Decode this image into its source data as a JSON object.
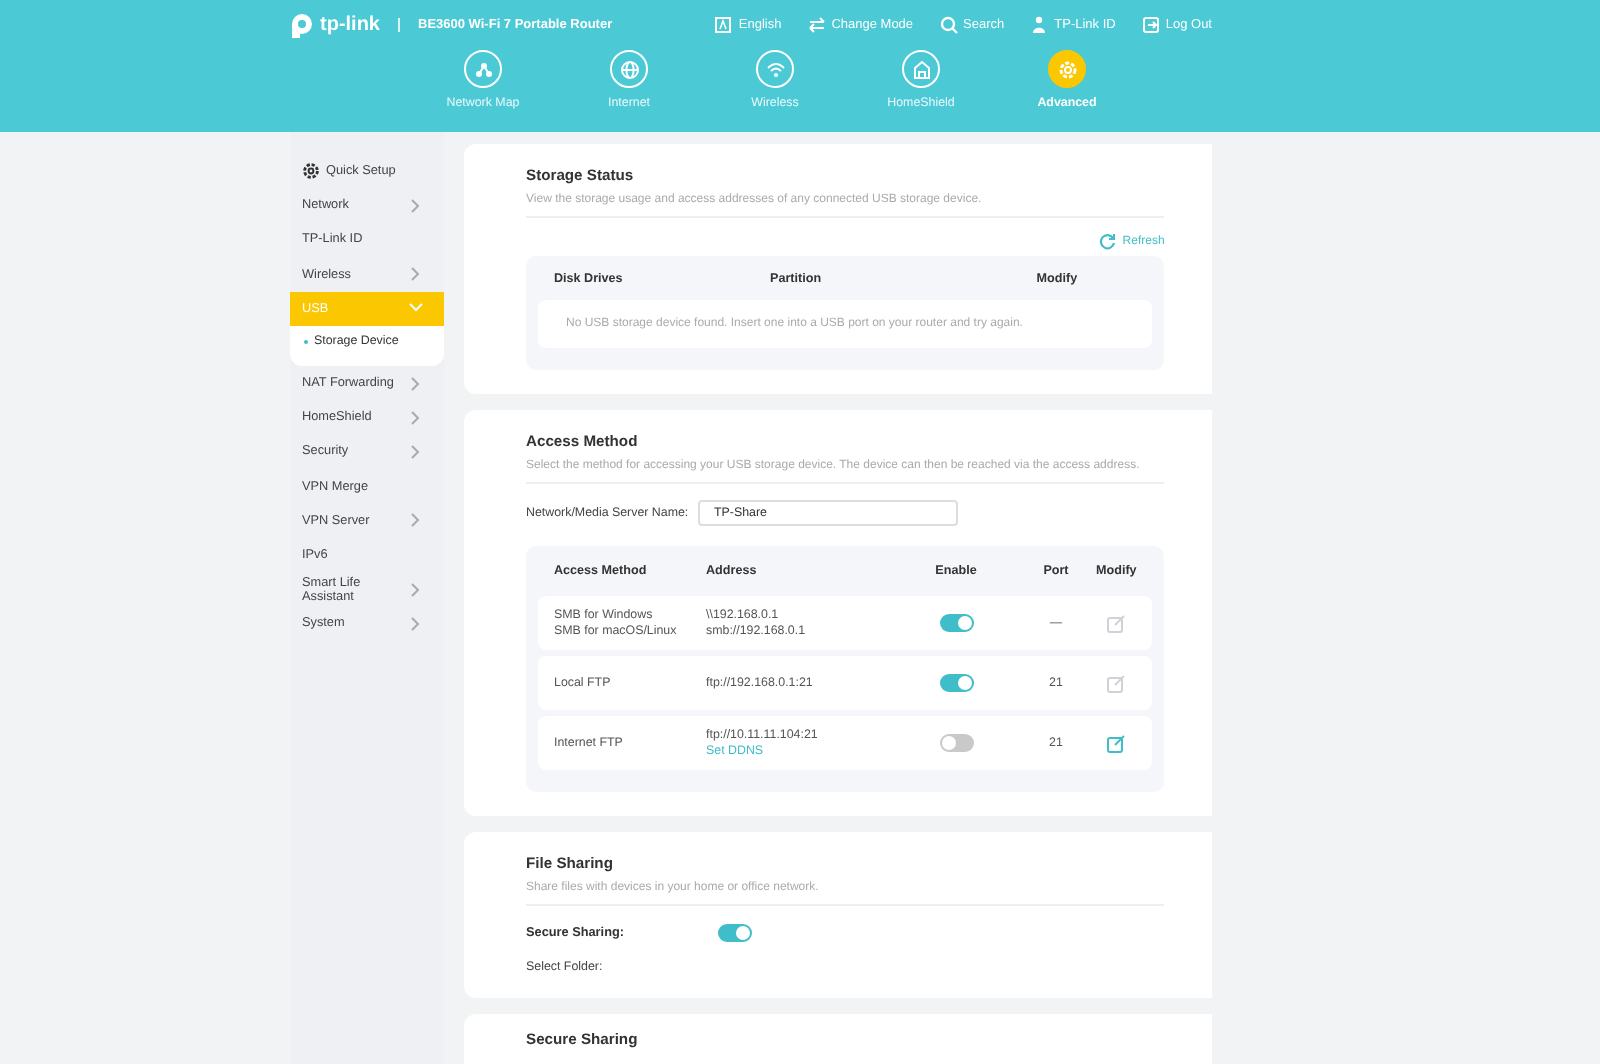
{
  "header": {
    "brand": "tp-link",
    "model": "BE3600 Wi-Fi 7 Portable Router",
    "links": [
      {
        "label": "English"
      },
      {
        "label": "Change Mode"
      },
      {
        "label": "Search"
      },
      {
        "label": "TP-Link ID"
      },
      {
        "label": "Log Out"
      }
    ],
    "tabs": [
      {
        "label": "Network Map",
        "selected": false
      },
      {
        "label": "Internet",
        "selected": false
      },
      {
        "label": "Wireless",
        "selected": false
      },
      {
        "label": "HomeShield",
        "selected": false
      },
      {
        "label": "Advanced",
        "selected": true
      }
    ]
  },
  "sidebar": {
    "items": [
      {
        "label": "Quick Setup",
        "kind": "setup",
        "selected": false
      },
      {
        "label": "Network",
        "kind": "group",
        "selected": false,
        "expanded": false
      },
      {
        "label": "TP-Link ID",
        "kind": "link",
        "selected": false
      },
      {
        "label": "Wireless",
        "kind": "group",
        "selected": false,
        "expanded": false
      },
      {
        "label": "USB",
        "kind": "group",
        "selected": true,
        "expanded": true,
        "children": [
          {
            "label": "Storage Device",
            "selected": true
          }
        ]
      },
      {
        "label": "NAT Forwarding",
        "kind": "group",
        "selected": false,
        "expanded": false
      },
      {
        "label": "HomeShield",
        "kind": "group",
        "selected": false,
        "expanded": false
      },
      {
        "label": "Security",
        "kind": "group",
        "selected": false,
        "expanded": false
      },
      {
        "label": "VPN Merge",
        "kind": "link",
        "selected": false
      },
      {
        "label": "VPN Server",
        "kind": "group",
        "selected": false,
        "expanded": false
      },
      {
        "label": "IPv6",
        "kind": "link",
        "selected": false
      },
      {
        "label": "Smart Life Assistant",
        "kind": "group",
        "selected": false,
        "expanded": false
      },
      {
        "label": "System",
        "kind": "group",
        "selected": false,
        "expanded": false
      }
    ]
  },
  "storage_status": {
    "title": "Storage Status",
    "description": "View the storage usage and access addresses of any connected USB storage device.",
    "refresh": "Refresh",
    "columns": [
      "Disk Drives",
      "Partition",
      "Modify"
    ],
    "empty_message": "No USB storage device found. Insert one into a USB port on your router and try again."
  },
  "access_method": {
    "title": "Access Method",
    "description": "Select the method for accessing your USB storage device. The device can then be reached via the access address.",
    "server_name": {
      "label": "Network/Media Server Name:",
      "value": "TP-Share"
    },
    "columns": [
      "Access Method",
      "Address",
      "Enable",
      "Port",
      "Modify"
    ],
    "rows": [
      {
        "methods": [
          "SMB for Windows",
          "SMB for macOS/Linux"
        ],
        "addresses": [
          "\\\\192.168.0.1",
          "smb://192.168.0.1"
        ],
        "enabled": true,
        "port": "—",
        "modify_disabled": true
      },
      {
        "methods": [
          "Local FTP"
        ],
        "addresses": [
          "ftp://192.168.0.1:21"
        ],
        "enabled": true,
        "port": "21",
        "modify_disabled": true
      },
      {
        "methods": [
          "Internet FTP"
        ],
        "addresses": [
          "ftp://10.11.11.104:21"
        ],
        "link": "Set DDNS",
        "enabled": false,
        "port": "21",
        "modify_disabled": false
      }
    ]
  },
  "file_sharing": {
    "title": "File Sharing",
    "description": "Share files with devices in your home or office network.",
    "secure_sharing": {
      "label": "Secure Sharing:",
      "on": true
    },
    "select_folder": "Select Folder:"
  },
  "next_section": {
    "title": "Secure Sharing"
  }
}
